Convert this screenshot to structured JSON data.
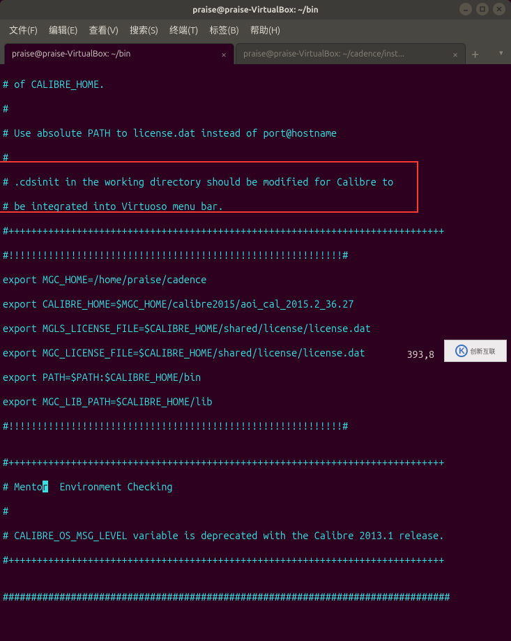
{
  "window": {
    "title": "praise@praise-VirtualBox: ~/bin"
  },
  "menu": {
    "file": "文件(F)",
    "edit": "编辑(E)",
    "view": "查看(V)",
    "search": "搜索(S)",
    "terminal": "终端(T)",
    "tabs": "标签(B)",
    "help": "帮助(H)"
  },
  "tabs": {
    "active": "praise@praise-VirtualBox: ~/bin",
    "inactive": "praise@praise-VirtualBox: ~/cadence/inst..."
  },
  "lines": {
    "l01": "# of CALIBRE_HOME.",
    "l02": "#",
    "l03": "# Use absolute PATH to license.dat instead of port@hostname",
    "l04": "#",
    "l05": "# .cdsinit in the working directory should be modified for Calibre to",
    "l06": "# be integrated into Virtuoso menu bar.",
    "l07": "#+++++++++++++++++++++++++++++++++++++++++++++++++++++++++++++++++++++++++++++",
    "l08": "#!!!!!!!!!!!!!!!!!!!!!!!!!!!!!!!!!!!!!!!!!!!!!!!!!!!!!!!!!!!#",
    "l09": "export MGC_HOME=/home/praise/cadence",
    "l10": "export CALIBRE_HOME=$MGC_HOME/calibre2015/aoi_cal_2015.2_36.27",
    "l11": "export MGLS_LICENSE_FILE=$CALIBRE_HOME/shared/license/license.dat",
    "l12": "export MGC_LICENSE_FILE=$CALIBRE_HOME/shared/license/license.dat",
    "l13": "export PATH=$PATH:$CALIBRE_HOME/bin",
    "l14": "export MGC_LIB_PATH=$CALIBRE_HOME/lib",
    "l15": "#!!!!!!!!!!!!!!!!!!!!!!!!!!!!!!!!!!!!!!!!!!!!!!!!!!!!!!!!!!!#",
    "l16": "",
    "l17": "#+++++++++++++++++++++++++++++++++++++++++++++++++++++++++++++++++++++++++++++",
    "l18a": "# Mento",
    "l18c": "r",
    "l18b": "  Environment Checking",
    "l19": "#",
    "l20": "# CALIBRE_OS_MSG_LEVEL variable is deprecated with the Calibre 2013.1 release.",
    "l21": "#+++++++++++++++++++++++++++++++++++++++++++++++++++++++++++++++++++++++++++++",
    "l22": "",
    "l23": "###############################################################################"
  },
  "status": {
    "pos": "393,8"
  },
  "watermark": {
    "text": "创新互联"
  }
}
